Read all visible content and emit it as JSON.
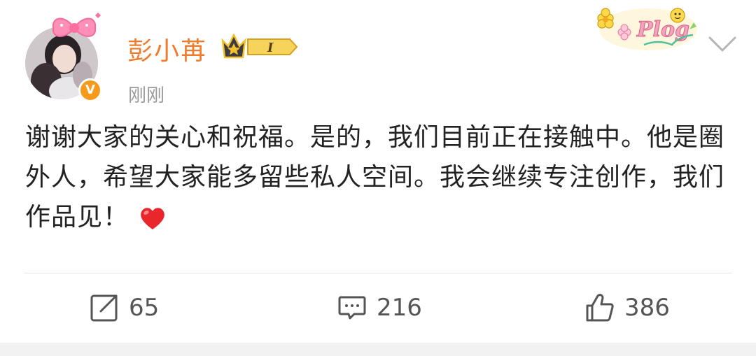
{
  "post": {
    "author": "彭小苒",
    "time": "刚刚",
    "verified_mark": "V",
    "rank_level": "I",
    "sticker_text": "Plog",
    "content": "谢谢大家的关心和祝福。是的，我们目前正在接触中。他是圈外人，希望大家能多留些私人空间。我会继续专注创作，我们作品见！",
    "emoji": "red-heart"
  },
  "actions": {
    "repost_count": "65",
    "comment_count": "216",
    "like_count": "386"
  },
  "colors": {
    "name": "#f07c2b",
    "verified": "#f59a1a",
    "heart": "#e8262b",
    "text": "#222222",
    "meta": "#9a9a9a"
  }
}
